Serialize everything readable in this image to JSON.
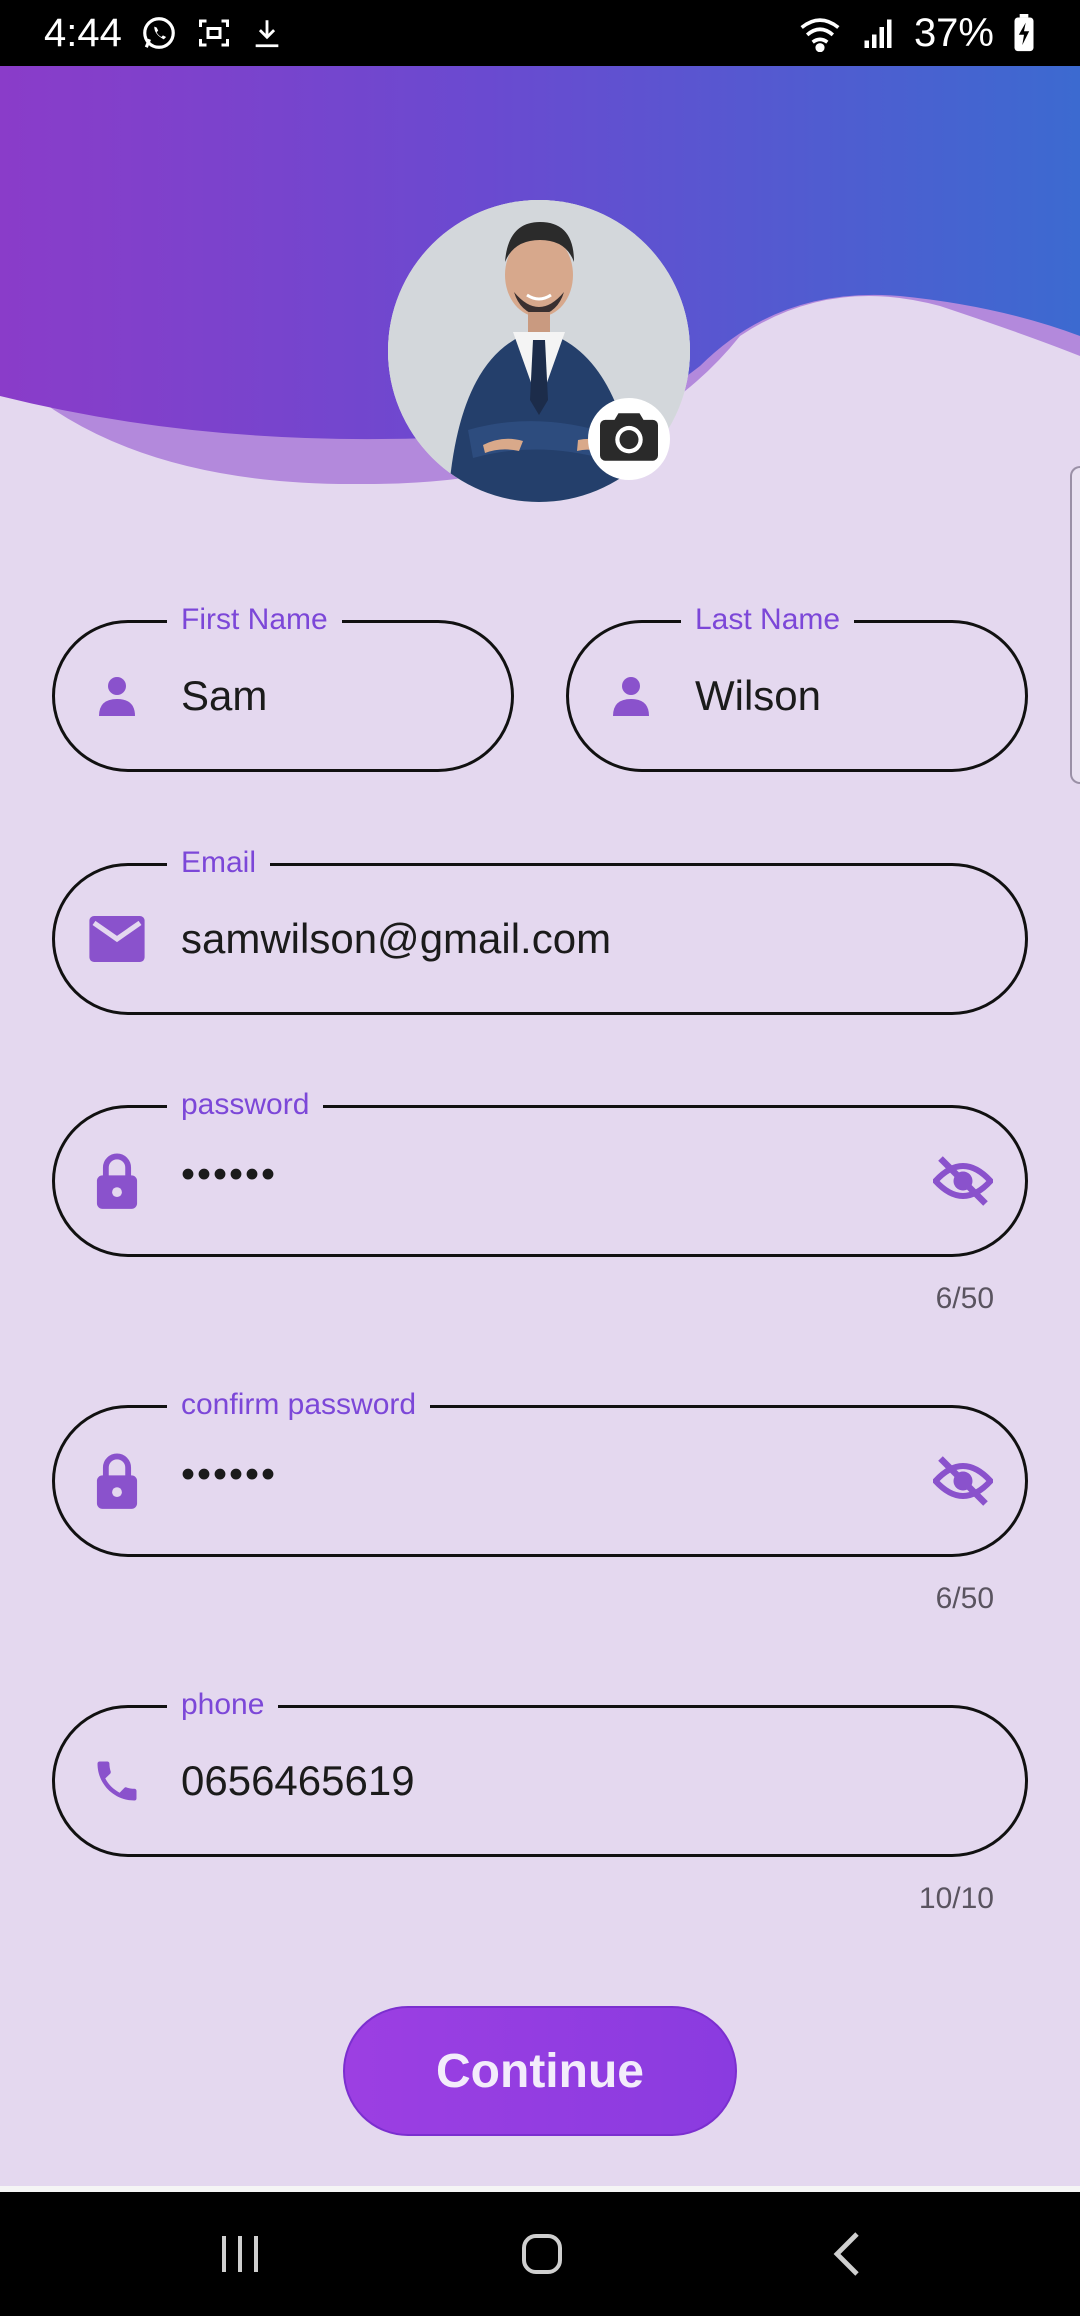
{
  "status_bar": {
    "time": "4:44",
    "battery": "37%",
    "icons": [
      "whatsapp-icon",
      "screen-record-icon",
      "download-icon",
      "wifi-icon",
      "signal-icon",
      "battery-charging-icon"
    ]
  },
  "header": {
    "avatar_alt": "profile-photo",
    "camera_icon": "camera-icon"
  },
  "form": {
    "first_name": {
      "label": "First Name",
      "value": "Sam",
      "icon": "person-icon"
    },
    "last_name": {
      "label": "Last Name",
      "value": "Wilson",
      "icon": "person-icon"
    },
    "email": {
      "label": "Email",
      "value": "samwilson@gmail.com",
      "icon": "mail-icon"
    },
    "password": {
      "label": "password",
      "value": "••••••",
      "counter": "6/50",
      "icon": "lock-icon",
      "toggle_icon": "visibility-off-icon"
    },
    "confirm_password": {
      "label": "confirm password",
      "value": "••••••",
      "counter": "6/50",
      "icon": "lock-icon",
      "toggle_icon": "visibility-off-icon"
    },
    "phone": {
      "label": "phone",
      "value": "0656465619",
      "counter": "10/10",
      "icon": "phone-icon"
    }
  },
  "continue_label": "Continue",
  "nav": [
    "recents-icon",
    "home-icon",
    "back-icon"
  ],
  "colors": {
    "accent": "#7c47d8",
    "background": "#e4d8ef",
    "header_gradient_start": "#8a3cc9",
    "header_gradient_end": "#3c6ad0",
    "button": "#9c3fe2"
  }
}
